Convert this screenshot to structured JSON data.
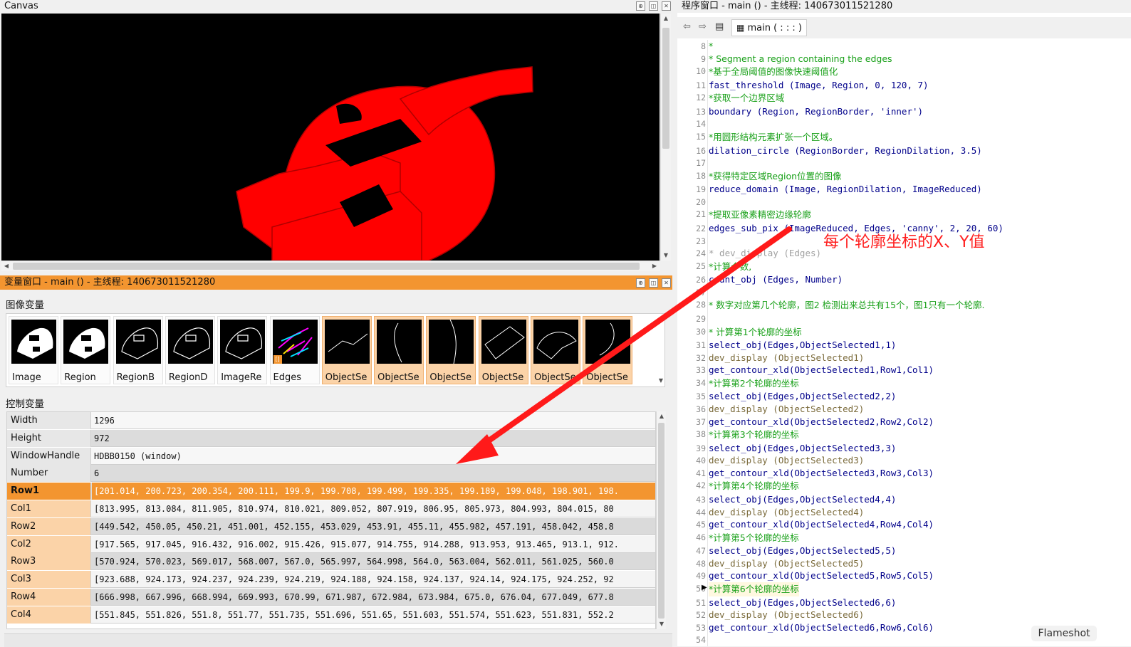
{
  "canvas": {
    "title": "Canvas"
  },
  "program_window": {
    "title": "程序窗口 - main () - 主线程: 140673011521280",
    "procedure_selector": "main ( : : : )",
    "lines": [
      {
        "n": "8",
        "text": "*",
        "kind": "cmt"
      },
      {
        "n": "9",
        "text": "* Segment a region containing the edges",
        "kind": "cmt"
      },
      {
        "n": "10",
        "text": "*基于全局阈值的图像快速阈值化",
        "kind": "cmt"
      },
      {
        "n": "11",
        "text": "fast_threshold (Image, Region, 0, 120, 7)",
        "kind": "op"
      },
      {
        "n": "12",
        "text": "*获取一个边界区域",
        "kind": "cmt"
      },
      {
        "n": "13",
        "text": "boundary (Region, RegionBorder, 'inner')",
        "kind": "op"
      },
      {
        "n": "14",
        "text": "",
        "kind": "op"
      },
      {
        "n": "15",
        "text": "*用圆形结构元素扩张一个区域。",
        "kind": "cmt"
      },
      {
        "n": "16",
        "text": "dilation_circle (RegionBorder, RegionDilation, 3.5)",
        "kind": "op"
      },
      {
        "n": "17",
        "text": "",
        "kind": "op"
      },
      {
        "n": "18",
        "text": "*获得特定区域Region位置的图像",
        "kind": "cmt"
      },
      {
        "n": "19",
        "text": "reduce_domain (Image, RegionDilation, ImageReduced)",
        "kind": "op"
      },
      {
        "n": "20",
        "text": "",
        "kind": "op"
      },
      {
        "n": "21",
        "text": "*提取亚像素精密边缘轮廓",
        "kind": "cmt"
      },
      {
        "n": "22",
        "text": "edges_sub_pix (ImageReduced, Edges, 'canny', 2, 20, 60)",
        "kind": "op"
      },
      {
        "n": "23",
        "text": "",
        "kind": "op"
      },
      {
        "n": "24",
        "text": "* dev_display (Edges)",
        "kind": "dis"
      },
      {
        "n": "25",
        "text": "*计算个数,",
        "kind": "cmt"
      },
      {
        "n": "26",
        "text": "count_obj (Edges, Number)",
        "kind": "op"
      },
      {
        "n": "27",
        "text": "",
        "kind": "op"
      },
      {
        "n": "28",
        "text": "* 数字对应第几个轮廓，图2 检测出来总共有15个，图1只有一个轮廓.",
        "kind": "cmt"
      },
      {
        "n": "29",
        "text": "",
        "kind": "op"
      },
      {
        "n": "30",
        "text": "* 计算第1个轮廓的坐标",
        "kind": "cmt"
      },
      {
        "n": "31",
        "text": "select_obj(Edges,ObjectSelected1,1)",
        "kind": "op"
      },
      {
        "n": "32",
        "text": "dev_display (ObjectSelected1)",
        "kind": "dev"
      },
      {
        "n": "33",
        "text": "get_contour_xld(ObjectSelected1,Row1,Col1)",
        "kind": "op"
      },
      {
        "n": "34",
        "text": "*计算第2个轮廓的坐标",
        "kind": "cmt"
      },
      {
        "n": "35",
        "text": "select_obj(Edges,ObjectSelected2,2)",
        "kind": "op"
      },
      {
        "n": "36",
        "text": "dev_display (ObjectSelected2)",
        "kind": "dev"
      },
      {
        "n": "37",
        "text": "get_contour_xld(ObjectSelected2,Row2,Col2)",
        "kind": "op"
      },
      {
        "n": "38",
        "text": "*计算第3个轮廓的坐标",
        "kind": "cmt"
      },
      {
        "n": "39",
        "text": "select_obj(Edges,ObjectSelected3,3)",
        "kind": "op"
      },
      {
        "n": "40",
        "text": "dev_display (ObjectSelected3)",
        "kind": "dev"
      },
      {
        "n": "41",
        "text": "get_contour_xld(ObjectSelected3,Row3,Col3)",
        "kind": "op"
      },
      {
        "n": "42",
        "text": "*计算第4个轮廓的坐标",
        "kind": "cmt"
      },
      {
        "n": "43",
        "text": "select_obj(Edges,ObjectSelected4,4)",
        "kind": "op"
      },
      {
        "n": "44",
        "text": "dev_display (ObjectSelected4)",
        "kind": "dev"
      },
      {
        "n": "45",
        "text": "get_contour_xld(ObjectSelected4,Row4,Col4)",
        "kind": "op"
      },
      {
        "n": "46",
        "text": "*计算第5个轮廓的坐标",
        "kind": "cmt"
      },
      {
        "n": "47",
        "text": "select_obj(Edges,ObjectSelected5,5)",
        "kind": "op"
      },
      {
        "n": "48",
        "text": "dev_display (ObjectSelected5)",
        "kind": "dev"
      },
      {
        "n": "49",
        "text": "get_contour_xld(ObjectSelected5,Row5,Col5)",
        "kind": "op"
      },
      {
        "n": "50",
        "text": "*计算第6个轮廓的坐标",
        "kind": "cmt"
      },
      {
        "n": "51",
        "text": "select_obj(Edges,ObjectSelected6,6)",
        "kind": "op"
      },
      {
        "n": "52",
        "text": "dev_display (ObjectSelected6)",
        "kind": "dev"
      },
      {
        "n": "53",
        "text": "get_contour_xld(ObjectSelected6,Row6,Col6)",
        "kind": "op"
      },
      {
        "n": "54",
        "text": "",
        "kind": "op"
      }
    ]
  },
  "variable_window": {
    "title": "变量窗口 - main () - 主线程: 140673011521280",
    "iconic_label": "图像变量",
    "control_label": "控制变量",
    "iconic_vars": [
      {
        "name": "Image",
        "kind": "image"
      },
      {
        "name": "Region",
        "kind": "image"
      },
      {
        "name": "RegionB",
        "kind": "image"
      },
      {
        "name": "RegionD",
        "kind": "image"
      },
      {
        "name": "ImageRe",
        "kind": "image"
      },
      {
        "name": "Edges",
        "kind": "image",
        "badge": "[]"
      },
      {
        "name": "ObjectSe",
        "kind": "obj"
      },
      {
        "name": "ObjectSe",
        "kind": "obj"
      },
      {
        "name": "ObjectSe",
        "kind": "obj"
      },
      {
        "name": "ObjectSe",
        "kind": "obj"
      },
      {
        "name": "ObjectSe",
        "kind": "obj"
      },
      {
        "name": "ObjectSe",
        "kind": "obj"
      }
    ],
    "control_vars": [
      {
        "name": "Width",
        "value": "1296",
        "state": "plain"
      },
      {
        "name": "Height",
        "value": "972",
        "state": "plain"
      },
      {
        "name": "WindowHandle",
        "value": "HDBB0150 (window)",
        "state": "plain"
      },
      {
        "name": "Number",
        "value": "6",
        "state": "plain"
      },
      {
        "name": "Row1",
        "value": "[201.014, 200.723, 200.354, 200.111, 199.9, 199.708, 199.499, 199.335, 199.189, 199.048, 198.901, 198.",
        "state": "sel"
      },
      {
        "name": "Col1",
        "value": "[813.995, 813.084, 811.905, 810.974, 810.021, 809.052, 807.919, 806.95, 805.973, 804.993, 804.015, 80",
        "state": "arr"
      },
      {
        "name": "Row2",
        "value": "[449.542, 450.05, 450.21, 451.001, 452.155, 453.029, 453.91, 455.11, 455.982, 457.191, 458.042, 458.8",
        "state": "arr"
      },
      {
        "name": "Col2",
        "value": "[917.565, 917.045, 916.432, 916.002, 915.426, 915.077, 914.755, 914.288, 913.953, 913.465, 913.1, 912.",
        "state": "arr"
      },
      {
        "name": "Row3",
        "value": "[570.924, 570.023, 569.017, 568.007, 567.0, 565.997, 564.998, 564.0, 563.004, 562.011, 561.025, 560.0",
        "state": "arr"
      },
      {
        "name": "Col3",
        "value": "[923.688, 924.173, 924.237, 924.239, 924.219, 924.188, 924.158, 924.137, 924.14, 924.175, 924.252, 92",
        "state": "arr"
      },
      {
        "name": "Row4",
        "value": "[666.998, 667.996, 668.994, 669.993, 670.99, 671.987, 672.984, 673.984, 675.0, 676.04, 677.049, 677.8",
        "state": "arr"
      },
      {
        "name": "Col4",
        "value": "[551.845, 551.826, 551.8, 551.77, 551.735, 551.696, 551.65, 551.603, 551.574, 551.623, 551.831, 552.2",
        "state": "arr"
      }
    ]
  },
  "annotation": {
    "text": "每个轮廓坐标的X、Y值",
    "color": "#ff2020"
  },
  "flameshot_label": "Flameshot",
  "colors": {
    "accent": "#f39530",
    "highlight_red": "#ff0000",
    "comment_green": "#18a018"
  }
}
